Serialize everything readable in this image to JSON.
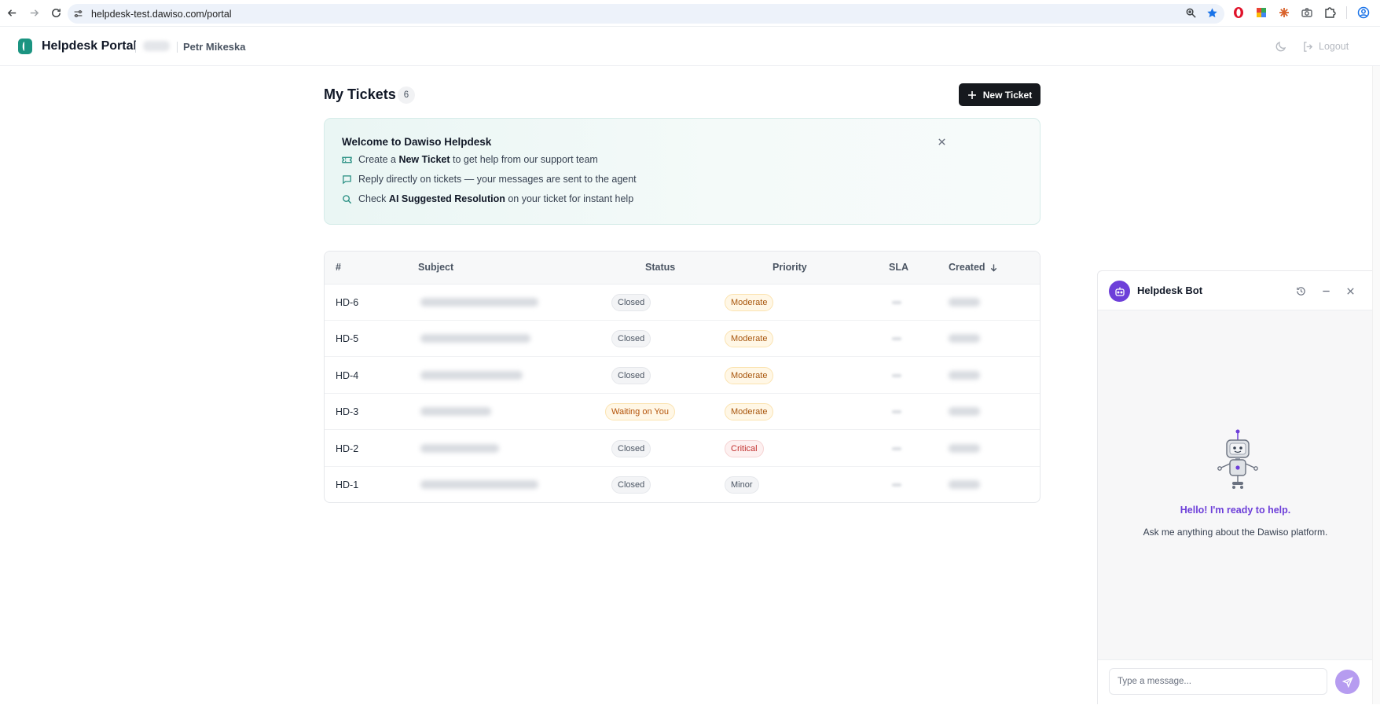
{
  "browser": {
    "url": "helpdesk-test.dawiso.com/portal"
  },
  "header": {
    "title": "Helpdesk Portal",
    "user_name": "Petr Mikeska",
    "logout_label": "Logout"
  },
  "page": {
    "title": "My Tickets",
    "count": "6",
    "new_ticket_label": "New Ticket"
  },
  "welcome": {
    "title": "Welcome to Dawiso Helpdesk",
    "tips": [
      {
        "before": "Create a ",
        "bold": "New Ticket",
        "after": " to get help from our support team"
      },
      {
        "before": "Reply directly on tickets — your messages are sent to the agent",
        "bold": "",
        "after": ""
      },
      {
        "before": "Check ",
        "bold": "AI Suggested Resolution",
        "after": " on your ticket for instant help"
      }
    ]
  },
  "table": {
    "columns": {
      "id": "#",
      "subject": "Subject",
      "status": "Status",
      "priority": "Priority",
      "sla": "SLA",
      "created": "Created"
    },
    "rows": [
      {
        "id": "HD-6",
        "status": "Closed",
        "status_kind": "closed",
        "priority": "Moderate",
        "priority_kind": "moderate"
      },
      {
        "id": "HD-5",
        "status": "Closed",
        "status_kind": "closed",
        "priority": "Moderate",
        "priority_kind": "moderate"
      },
      {
        "id": "HD-4",
        "status": "Closed",
        "status_kind": "closed",
        "priority": "Moderate",
        "priority_kind": "moderate"
      },
      {
        "id": "HD-3",
        "status": "Waiting on You",
        "status_kind": "waiting",
        "priority": "Moderate",
        "priority_kind": "moderate"
      },
      {
        "id": "HD-2",
        "status": "Closed",
        "status_kind": "closed",
        "priority": "Critical",
        "priority_kind": "critical"
      },
      {
        "id": "HD-1",
        "status": "Closed",
        "status_kind": "closed",
        "priority": "Minor",
        "priority_kind": "minor"
      }
    ]
  },
  "chat": {
    "title": "Helpdesk Bot",
    "hello": "Hello! I'm ready to help.",
    "subtitle": "Ask me anything about the Dawiso platform.",
    "input_placeholder": "Type a message..."
  },
  "colors": {
    "accent_teal": "#1f8a7d",
    "bot_purple": "#6d3fd9",
    "primary_button": "#16191e"
  }
}
